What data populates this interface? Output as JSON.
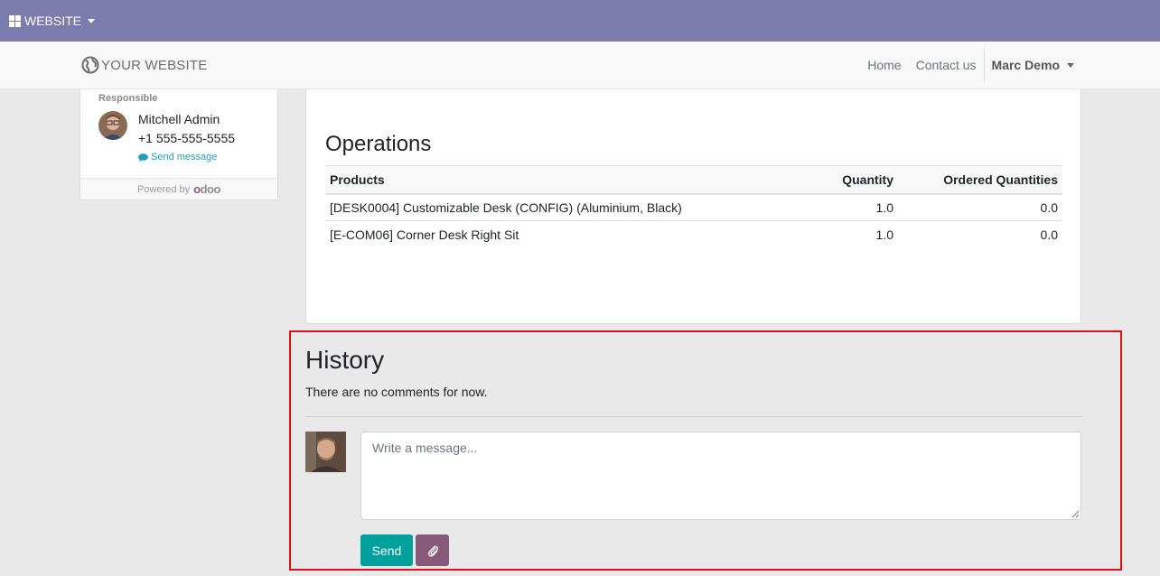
{
  "topbar": {
    "app_menu_label": "WEBSITE"
  },
  "navbar": {
    "brand": "YOUR WEBSITE",
    "links": [
      {
        "label": "Home"
      },
      {
        "label": "Contact us"
      }
    ],
    "user_name": "Marc Demo"
  },
  "sidebar": {
    "responsible_label": "Responsible",
    "name": "Mitchell Admin",
    "phone": "+1 555-555-5555",
    "send_message": "Send message",
    "powered_by": "Powered by",
    "powered_logo": "odoo"
  },
  "operations": {
    "title": "Operations",
    "columns": [
      "Products",
      "Quantity",
      "Ordered Quantities"
    ],
    "rows": [
      {
        "product": "[DESK0004] Customizable Desk (CONFIG) (Aluminium, Black)",
        "quantity": "1.0",
        "ordered": "0.0"
      },
      {
        "product": "[E-COM06] Corner Desk Right Sit",
        "quantity": "1.0",
        "ordered": "0.0"
      }
    ]
  },
  "history": {
    "title": "History",
    "empty_text": "There are no comments for now.",
    "message_placeholder": "Write a message...",
    "send_label": "Send",
    "attach_icon": "paperclip-icon"
  },
  "colors": {
    "topbar": "#7c7bad",
    "primary": "#00a09d",
    "secondary": "#875a7b",
    "highlight_frame": "#e01010"
  }
}
